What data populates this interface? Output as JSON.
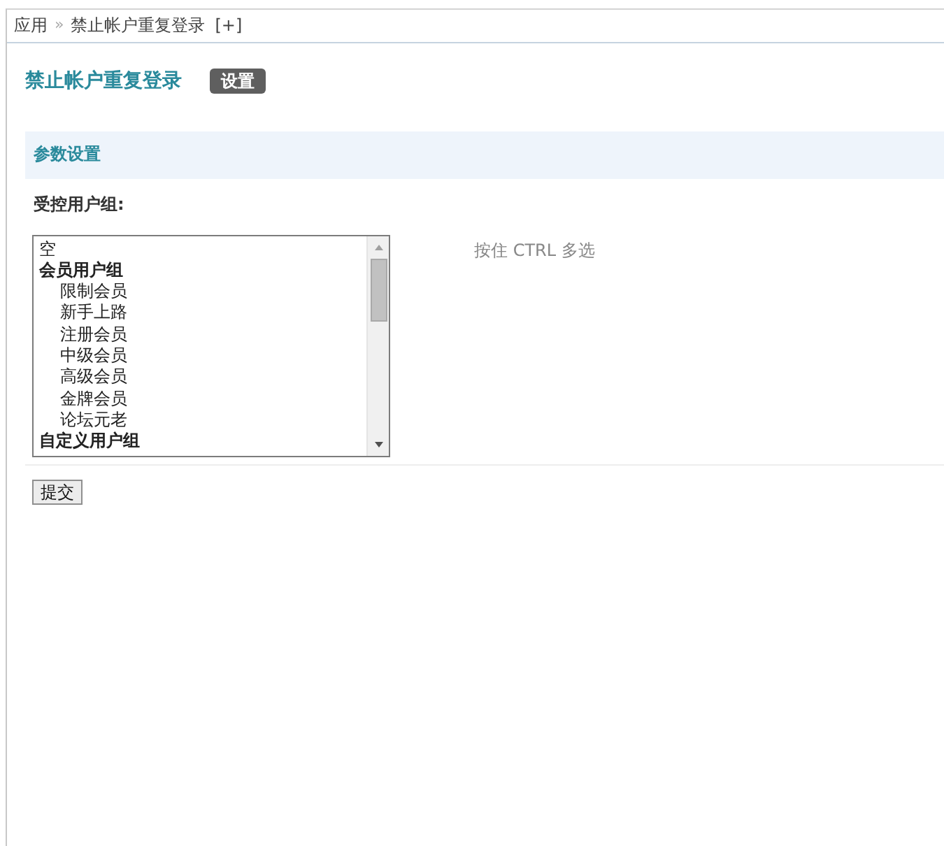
{
  "breadcrumb": {
    "items": [
      "应用",
      "禁止帐户重复登录"
    ],
    "separator": "»",
    "add_link": "[+]"
  },
  "header": {
    "title": "禁止帐户重复登录",
    "tabs": [
      {
        "label": "设置",
        "selected": true
      }
    ]
  },
  "section": {
    "title": "参数设置"
  },
  "field": {
    "label": "受控用户组:",
    "hint": "按住 CTRL 多选",
    "options": [
      {
        "kind": "option",
        "label": "空",
        "selected": false
      },
      {
        "kind": "group",
        "label": "会员用户组",
        "children": [
          {
            "kind": "option",
            "label": "限制会员",
            "selected": false
          },
          {
            "kind": "option",
            "label": "新手上路",
            "selected": false
          },
          {
            "kind": "option",
            "label": "注册会员",
            "selected": false
          },
          {
            "kind": "option",
            "label": "中级会员",
            "selected": false
          },
          {
            "kind": "option",
            "label": "高级会员",
            "selected": false
          },
          {
            "kind": "option",
            "label": "金牌会员",
            "selected": false
          },
          {
            "kind": "option",
            "label": "论坛元老",
            "selected": false
          }
        ]
      },
      {
        "kind": "group",
        "label": "自定义用户组"
      }
    ]
  },
  "submit": {
    "label": "提交"
  }
}
